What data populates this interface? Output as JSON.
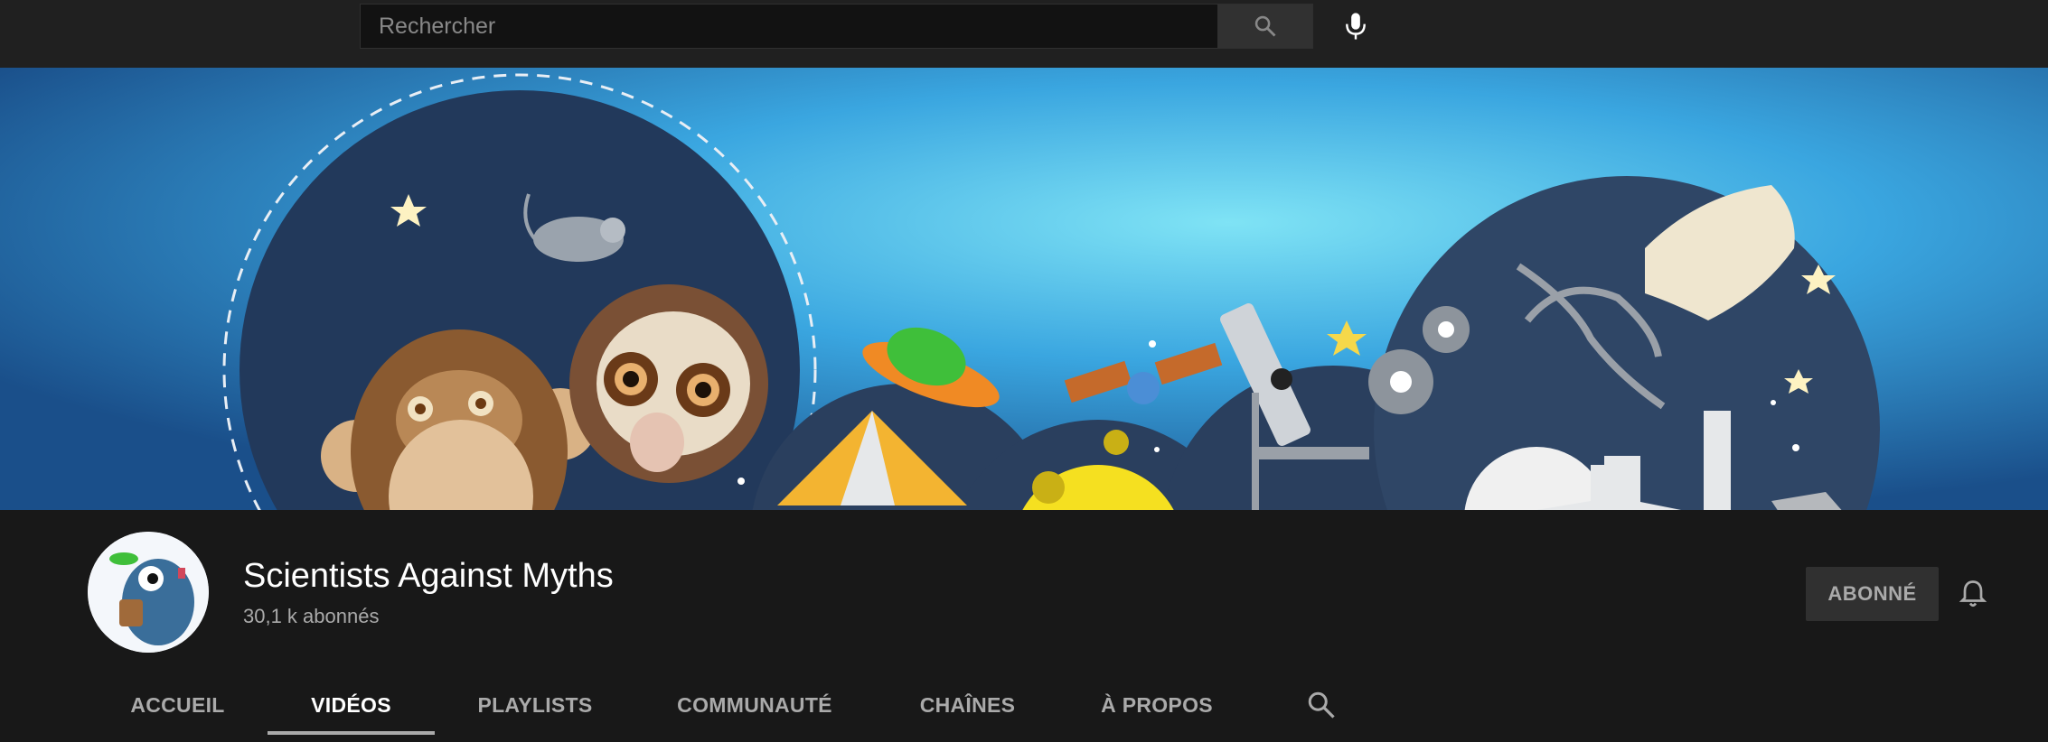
{
  "search": {
    "placeholder": "Rechercher"
  },
  "icons": {
    "search": "search-icon",
    "mic": "microphone-icon",
    "bell": "bell-icon"
  },
  "channel": {
    "title": "Scientists Against Myths",
    "subscribers": "30,1 k abonnés",
    "subscribed_label": "ABONNÉ"
  },
  "tabs": [
    {
      "label": "ACCUEIL",
      "active": false
    },
    {
      "label": "VIDÉOS",
      "active": true
    },
    {
      "label": "PLAYLISTS",
      "active": false
    },
    {
      "label": "COMMUNAUTÉ",
      "active": false
    },
    {
      "label": "CHAÎNES",
      "active": false
    },
    {
      "label": "À PROPOS",
      "active": false
    }
  ],
  "colors": {
    "background": "#181818",
    "topbar": "#202020",
    "banner_sky": "#3aa6e0",
    "text_secondary": "#aaaaaa"
  }
}
